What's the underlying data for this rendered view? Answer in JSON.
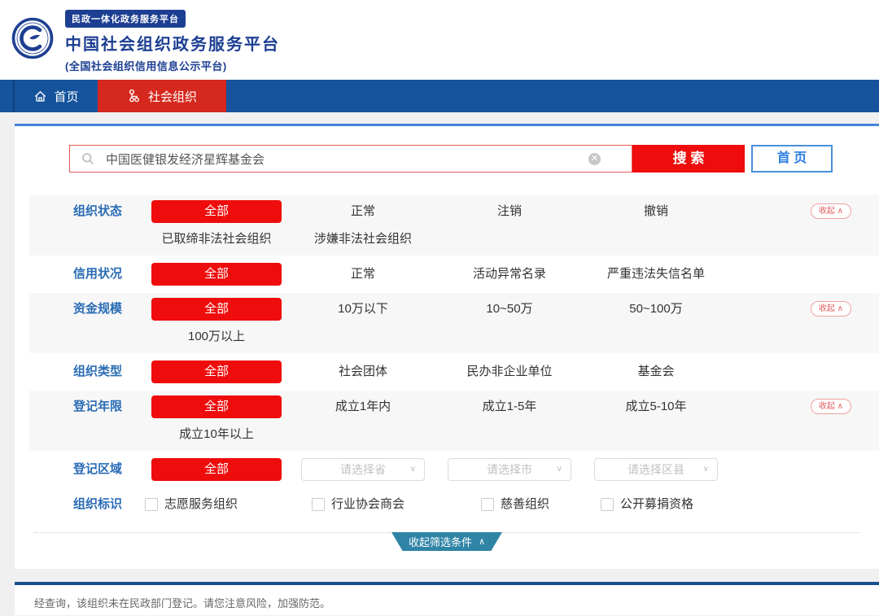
{
  "header": {
    "badge": "民政一体化政务服务平台",
    "title": "中国社会组织政务服务平台",
    "subtitle": "(全国社会组织信用信息公示平台)"
  },
  "nav": {
    "items": [
      {
        "label": "首页",
        "icon": "home-icon",
        "active": false
      },
      {
        "label": "社会组织",
        "icon": "org-chart-icon",
        "active": true
      }
    ]
  },
  "search": {
    "value": "中国医健银发经济星辉基金会",
    "search_button": "搜 索",
    "home_button": "首 页"
  },
  "filters": {
    "collapse_small": "收起",
    "rows": [
      {
        "label": "组织状态",
        "shaded": true,
        "collapse": true,
        "lines": [
          [
            {
              "t": "全部",
              "s": "active"
            },
            {
              "t": "正常",
              "s": "plain"
            },
            {
              "t": "注销",
              "s": "plain"
            },
            {
              "t": "撤销",
              "s": "plain"
            }
          ],
          [
            {
              "t": "已取缔非法社会组织",
              "s": "plain"
            },
            {
              "t": "涉嫌非法社会组织",
              "s": "plain"
            }
          ]
        ]
      },
      {
        "label": "信用状况",
        "shaded": false,
        "collapse": false,
        "lines": [
          [
            {
              "t": "全部",
              "s": "active"
            },
            {
              "t": "正常",
              "s": "plain"
            },
            {
              "t": "活动异常名录",
              "s": "plain"
            },
            {
              "t": "严重违法失信名单",
              "s": "plain"
            }
          ]
        ]
      },
      {
        "label": "资金规模",
        "shaded": true,
        "collapse": true,
        "lines": [
          [
            {
              "t": "全部",
              "s": "active"
            },
            {
              "t": "10万以下",
              "s": "plain"
            },
            {
              "t": "10~50万",
              "s": "plain"
            },
            {
              "t": "50~100万",
              "s": "plain"
            }
          ],
          [
            {
              "t": "100万以上",
              "s": "plain"
            }
          ]
        ]
      },
      {
        "label": "组织类型",
        "shaded": false,
        "collapse": false,
        "lines": [
          [
            {
              "t": "全部",
              "s": "active"
            },
            {
              "t": "社会团体",
              "s": "plain"
            },
            {
              "t": "民办非企业单位",
              "s": "plain"
            },
            {
              "t": "基金会",
              "s": "plain"
            }
          ]
        ]
      },
      {
        "label": "登记年限",
        "shaded": true,
        "collapse": true,
        "lines": [
          [
            {
              "t": "全部",
              "s": "active"
            },
            {
              "t": "成立1年内",
              "s": "plain"
            },
            {
              "t": "成立1-5年",
              "s": "plain"
            },
            {
              "t": "成立5-10年",
              "s": "plain"
            }
          ],
          [
            {
              "t": "成立10年以上",
              "s": "plain"
            }
          ]
        ]
      },
      {
        "label": "登记区域",
        "shaded": false,
        "collapse": false,
        "lines": [
          [
            {
              "t": "全部",
              "s": "active"
            },
            {
              "t": "请选择省",
              "s": "select"
            },
            {
              "t": "请选择市",
              "s": "select"
            },
            {
              "t": "请选择区县",
              "s": "select"
            }
          ]
        ]
      },
      {
        "label": "组织标识",
        "shaded": false,
        "collapse": false,
        "lines": [
          [
            {
              "t": "志愿服务组织",
              "s": "checkbox"
            },
            {
              "t": "行业协会商会",
              "s": "checkbox"
            },
            {
              "t": "慈善组织",
              "s": "checkbox"
            },
            {
              "t": "公开募捐资格",
              "s": "checkbox"
            }
          ]
        ]
      }
    ]
  },
  "collapse_bar": {
    "label": "收起筛选条件",
    "caret": "∧"
  },
  "icons": {
    "chevron_down": "∨",
    "chevron_up": "∧",
    "clear": "✕"
  },
  "footer": {
    "message": "经查询，该组织未在民政部门登记。请您注意风险，加强防范。"
  },
  "colors": {
    "nav_blue": "#15549c",
    "tab_red": "#d5281e",
    "button_red": "#ee0c0c",
    "brand_blue": "#1d3f92",
    "label_blue": "#2a6cb5",
    "panel_border_blue": "#4282d6",
    "footer_line_blue": "#17508f",
    "ribbon_teal": "#2f84a6"
  }
}
